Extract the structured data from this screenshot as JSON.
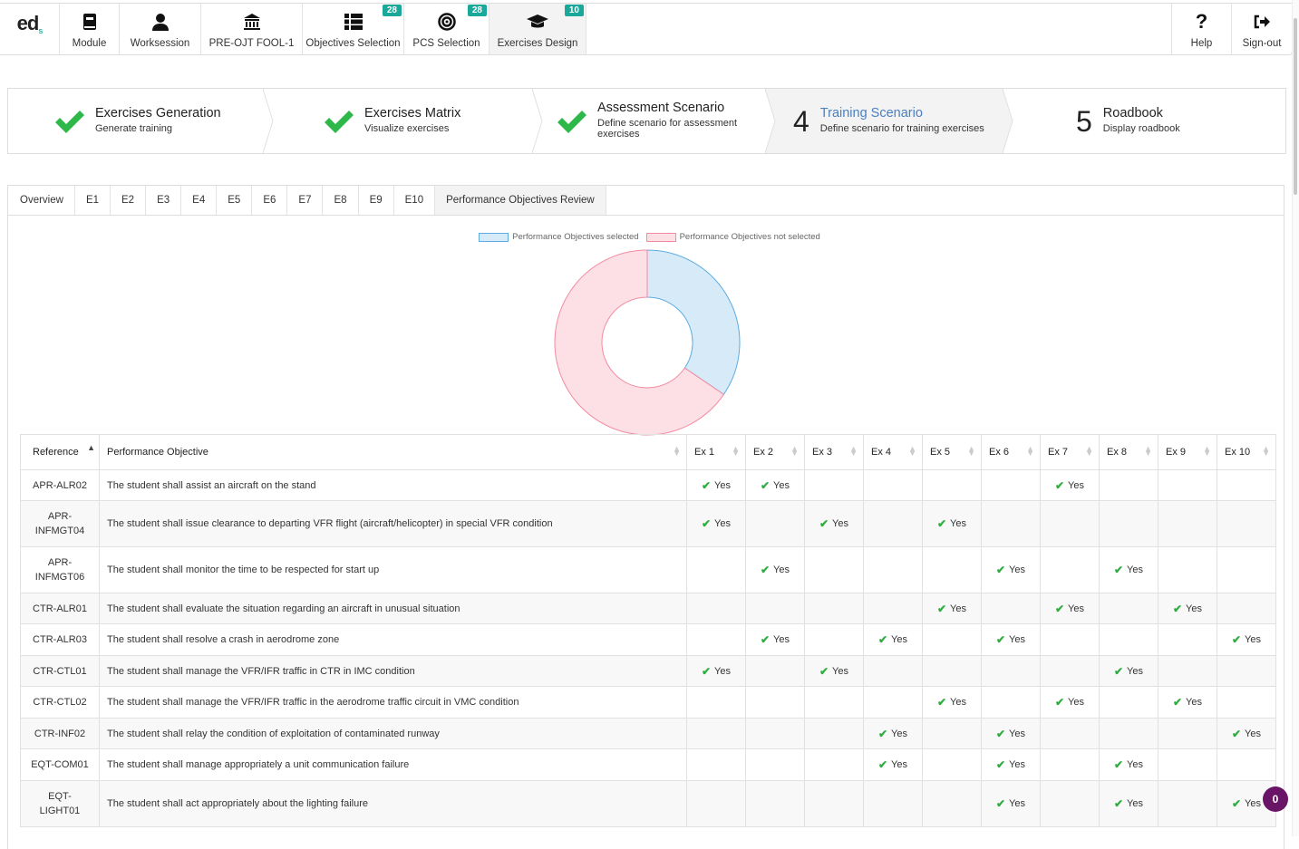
{
  "app": {
    "logo_text": "ed",
    "logo_dot": "s"
  },
  "nav": {
    "items": [
      {
        "label": "Module",
        "icon": "book-icon",
        "badge": null
      },
      {
        "label": "Worksession",
        "icon": "user-icon",
        "badge": null
      },
      {
        "label": "PRE-OJT FOOL-1",
        "icon": "institution-icon",
        "badge": null
      },
      {
        "label": "Objectives Selection",
        "icon": "list-icon",
        "badge": "28"
      },
      {
        "label": "PCS Selection",
        "icon": "target-icon",
        "badge": "28"
      },
      {
        "label": "Exercises Design",
        "icon": "graduation-cap-icon",
        "badge": "10",
        "active": true
      }
    ],
    "help_label": "Help",
    "signout_label": "Sign-out"
  },
  "wizard": {
    "steps": [
      {
        "status": "done",
        "title": "Exercises Generation",
        "subtitle": "Generate training"
      },
      {
        "status": "done",
        "title": "Exercises Matrix",
        "subtitle": "Visualize exercises"
      },
      {
        "status": "done",
        "title": "Assessment Scenario",
        "subtitle": "Define scenario for assessment exercises"
      },
      {
        "status": "current",
        "number": "4",
        "title": "Training Scenario",
        "subtitle": "Define scenario for training exercises"
      },
      {
        "status": "todo",
        "number": "5",
        "title": "Roadbook",
        "subtitle": "Display roadbook"
      }
    ]
  },
  "tabs": [
    "Overview",
    "E1",
    "E2",
    "E3",
    "E4",
    "E5",
    "E6",
    "E7",
    "E8",
    "E9",
    "E10",
    "Performance Objectives Review"
  ],
  "active_tab": "Performance Objectives Review",
  "chart_data": {
    "type": "pie",
    "variant": "doughnut",
    "title": "",
    "labels": [
      "Performance Objectives selected",
      "Performance Objectives not selected"
    ],
    "values": [
      34.5,
      65.5
    ],
    "value_unit": "percent (estimated)",
    "colors": {
      "selected_fill": "#d6eaf8",
      "selected_stroke": "#5dade2",
      "not_selected_fill": "#fde0e6",
      "not_selected_stroke": "#f38ba0"
    },
    "legend": "top"
  },
  "table": {
    "columns": [
      "Reference",
      "Performance Objective",
      "Ex 1",
      "Ex 2",
      "Ex 3",
      "Ex 4",
      "Ex 5",
      "Ex 6",
      "Ex 7",
      "Ex 8",
      "Ex 9",
      "Ex 10"
    ],
    "sorted_column": "Reference",
    "yes_label": "Yes",
    "rows": [
      {
        "ref": "APR-ALR02",
        "objective": "The student shall assist an aircraft on the stand",
        "ex": [
          1,
          1,
          0,
          0,
          0,
          0,
          1,
          0,
          0,
          0
        ]
      },
      {
        "ref": "APR-INFMGT04",
        "objective": "The student shall issue clearance to departing VFR flight (aircraft/helicopter) in special VFR condition",
        "ex": [
          1,
          0,
          1,
          0,
          1,
          0,
          0,
          0,
          0,
          0
        ]
      },
      {
        "ref": "APR-INFMGT06",
        "objective": "The student shall monitor the time to be respected for start up",
        "ex": [
          0,
          1,
          0,
          0,
          0,
          1,
          0,
          1,
          0,
          0
        ]
      },
      {
        "ref": "CTR-ALR01",
        "objective": "The student shall evaluate the situation regarding an aircraft in unusual situation",
        "ex": [
          0,
          0,
          0,
          0,
          1,
          0,
          1,
          0,
          1,
          0
        ]
      },
      {
        "ref": "CTR-ALR03",
        "objective": "The student shall resolve a crash in aerodrome zone",
        "ex": [
          0,
          1,
          0,
          1,
          0,
          1,
          0,
          0,
          0,
          1
        ]
      },
      {
        "ref": "CTR-CTL01",
        "objective": "The student shall manage the VFR/IFR traffic in CTR in IMC condition",
        "ex": [
          1,
          0,
          1,
          0,
          0,
          0,
          0,
          1,
          0,
          0
        ]
      },
      {
        "ref": "CTR-CTL02",
        "objective": "The student shall manage the VFR/IFR traffic in the aerodrome traffic circuit in VMC condition",
        "ex": [
          0,
          0,
          0,
          0,
          1,
          0,
          1,
          0,
          1,
          0
        ]
      },
      {
        "ref": "CTR-INF02",
        "objective": "The student shall relay the condition of exploitation of contaminated runway",
        "ex": [
          0,
          0,
          0,
          1,
          0,
          1,
          0,
          0,
          0,
          1
        ]
      },
      {
        "ref": "EQT-COM01",
        "objective": "The student shall manage appropriately a unit communication failure",
        "ex": [
          0,
          0,
          0,
          1,
          0,
          1,
          0,
          1,
          0,
          0
        ]
      },
      {
        "ref": "EQT-LIGHT01",
        "objective": "The student shall act appropriately about the lighting failure",
        "ex": [
          0,
          0,
          0,
          0,
          0,
          1,
          0,
          1,
          0,
          1
        ]
      }
    ]
  },
  "notification_count": "0"
}
